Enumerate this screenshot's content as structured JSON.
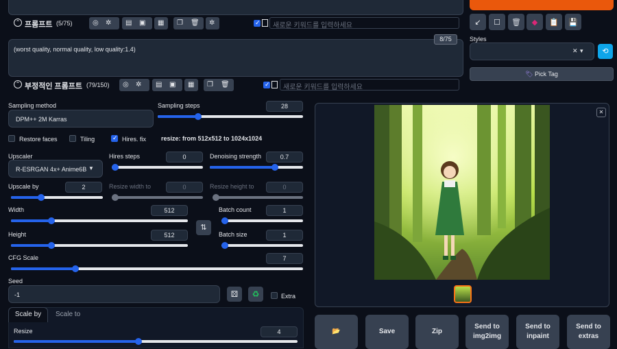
{
  "prompt": {
    "label": "프롬프트",
    "count": "(5/75)",
    "keyword_placeholder": "새로운 키워드를 입력하세요"
  },
  "negative": {
    "text": "(worst quality, normal quality, low quality:1.4)",
    "counter": "8/75",
    "label": "부정적인 프롬프트",
    "count": "(79/150)",
    "keyword_placeholder": "새로운 키워드를 입력하세요"
  },
  "styles": {
    "label": "Styles",
    "clear": "✕",
    "dropdown": "▾"
  },
  "pick_tag": {
    "label": "Pick Tag",
    "icon": "🏷"
  },
  "sampling": {
    "method_label": "Sampling method",
    "method_value": "DPM++ 2M Karras",
    "steps_label": "Sampling steps",
    "steps_value": "28",
    "steps": 0.28
  },
  "checks": {
    "restore_faces": "Restore faces",
    "tiling": "Tiling",
    "hires_fix": "Hires. fix",
    "resize_info": "resize: from 512x512 to 1024x1024"
  },
  "hires": {
    "upscaler_label": "Upscaler",
    "upscaler_value": "R-ESRGAN 4x+ Anime6B",
    "steps_label": "Hires steps",
    "steps_value": "0",
    "steps": 0,
    "denoise_label": "Denoising strength",
    "denoise_value": "0.7",
    "denoise": 0.7,
    "upscale_label": "Upscale by",
    "upscale_value": "2",
    "upscale": 0.33,
    "rw_label": "Resize width to",
    "rw_value": "0",
    "rh_label": "Resize height to",
    "rh_value": "0"
  },
  "size": {
    "width_label": "Width",
    "width_value": "512",
    "width": 0.23,
    "height_label": "Height",
    "height_value": "512",
    "height": 0.23,
    "swap_icon": "⇅"
  },
  "batch": {
    "count_label": "Batch count",
    "count_value": "1",
    "count": 0,
    "size_label": "Batch size",
    "size_value": "1",
    "size": 0
  },
  "cfg": {
    "label": "CFG Scale",
    "value": "7",
    "cfg": 0.22
  },
  "seed": {
    "label": "Seed",
    "value": "-1",
    "extra": "Extra"
  },
  "tabs": {
    "scale_by": "Scale by",
    "scale_to": "Scale to"
  },
  "resize": {
    "label": "Resize",
    "value": "4",
    "resize": 0.44
  },
  "image_close": "✕",
  "actions": {
    "folder": "📂",
    "save": "Save",
    "zip": "Zip",
    "img2img": "Send to img2img",
    "inpaint": "Send to inpaint",
    "extras": "Send to extras"
  },
  "colors": {
    "accent": "#2563eb",
    "generate": "#ea580c",
    "bg": "#0b0f19"
  }
}
